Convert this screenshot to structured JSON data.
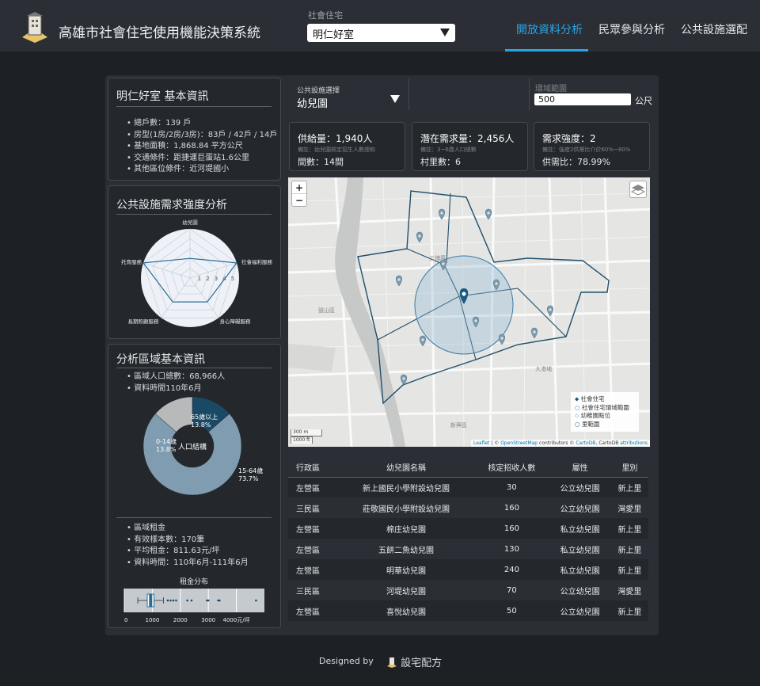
{
  "header": {
    "title": "高雄市社會住宅使用機能決策系統",
    "select_label": "社會住宅",
    "select_value": "明仁好室",
    "nav": [
      "開放資料分析",
      "民眾參與分析",
      "公共設施選配"
    ]
  },
  "info": {
    "title": "明仁好室 基本資訊",
    "items": [
      "總戶數：139 戶",
      "房型(1房/2房/3房)：83戶 / 42戶 / 14戶",
      "基地面積：1,868.84 平方公尺",
      "交通條件：距捷運巨蛋站1.6公里",
      "其他區位條件：近河堤國小"
    ]
  },
  "radar": {
    "title": "公共設施需求強度分析",
    "axes": [
      "幼兒園",
      "社會福利服務",
      "身心障礙服務",
      "長期照顧服務",
      "托育服務"
    ],
    "ticks": [
      "1",
      "2",
      "3",
      "4",
      "5"
    ],
    "values": [
      2,
      5,
      3,
      3,
      5
    ]
  },
  "region": {
    "title": "分析區域基本資訊",
    "items": [
      "區域人口總數：68,966人",
      "資料時間110年6月"
    ],
    "donut_center": "人口結構",
    "segments": [
      {
        "label": "65歲以上",
        "pct": "13.8%",
        "value": 13.8,
        "color": "#1a4966"
      },
      {
        "label": "15-64歲",
        "pct": "73.7%",
        "value": 73.7,
        "color": "#7f9cb0"
      },
      {
        "label": "0-14歲",
        "pct": "13.8%",
        "value": 13.8,
        "color": "#b7b9bb"
      }
    ]
  },
  "rent": {
    "items": [
      "區域租金",
      "有效樣本數：170筆",
      "平均租金：811.63元/坪",
      "資料時間：110年6月-111年6月"
    ],
    "chart_title": "租金分布",
    "ticks": [
      "0",
      "1000",
      "2000",
      "3000",
      "4000元/坪"
    ],
    "box": {
      "min": 480,
      "q1": 820,
      "median": 940,
      "q3": 1060,
      "max": 1400
    },
    "outliers": [
      1550,
      1650,
      1750,
      1850,
      2250,
      2400,
      2950,
      3000,
      3350,
      3400,
      4700
    ]
  },
  "filters": {
    "facility_label": "公共設施選擇",
    "facility_value": "幼兒園",
    "radius_label": "環域範圍",
    "radius_value": "500",
    "radius_unit": "公尺"
  },
  "stats": [
    {
      "main": "供給量：1,940人",
      "note": "備註：幼兒園核定招生人數總和",
      "sub": "間數：14間"
    },
    {
      "main": "潛在需求量：2,456人",
      "note": "備註：3~6歲人口總數",
      "sub": "村里數：6"
    },
    {
      "main": "需求強度：2",
      "note": "備註：強度2供需比介於60%~80%",
      "sub": "供需比：78.99%"
    }
  ],
  "map": {
    "labels": [
      "三塊厝",
      "鼓山區",
      "大港埔",
      "新興區"
    ],
    "legend": [
      "社會住宅",
      "社會住宅環域範圍",
      "幼稚園點位",
      "里範圍"
    ],
    "zoom_in": "+",
    "zoom_out": "−",
    "scale": [
      "300 m",
      "1000 ft"
    ],
    "attribution_links": [
      "Leaflet",
      "OpenStreetMap",
      "CartoDB",
      "attributions"
    ],
    "attribution_text": [
      "© ",
      " contributors © ",
      ", CartoDB "
    ]
  },
  "table": {
    "headers": [
      "行政區",
      "幼兒園名稱",
      "核定招收人數",
      "屬性",
      "里別"
    ],
    "rows": [
      [
        "左營區",
        "新上國民小學附設幼兒園",
        "30",
        "公立幼兒園",
        "新上里"
      ],
      [
        "三民區",
        "莊敬國民小學附設幼兒園",
        "160",
        "公立幼兒園",
        "灣愛里"
      ],
      [
        "左營區",
        "棉庄幼兒園",
        "160",
        "私立幼兒園",
        "新上里"
      ],
      [
        "左營區",
        "五餅二魚幼兒園",
        "130",
        "私立幼兒園",
        "新上里"
      ],
      [
        "左營區",
        "明華幼兒園",
        "240",
        "私立幼兒園",
        "新上里"
      ],
      [
        "三民區",
        "河堤幼兒園",
        "70",
        "公立幼兒園",
        "灣愛里"
      ],
      [
        "左營區",
        "喜悅幼兒園",
        "50",
        "公立幼兒園",
        "新上里"
      ]
    ]
  },
  "footer": {
    "designed_by": "Designed by",
    "brand": "設宅配方"
  },
  "colors": {
    "accent": "#2aa4e6",
    "pin": "#1a5a80",
    "panel": "#2b2f35"
  }
}
